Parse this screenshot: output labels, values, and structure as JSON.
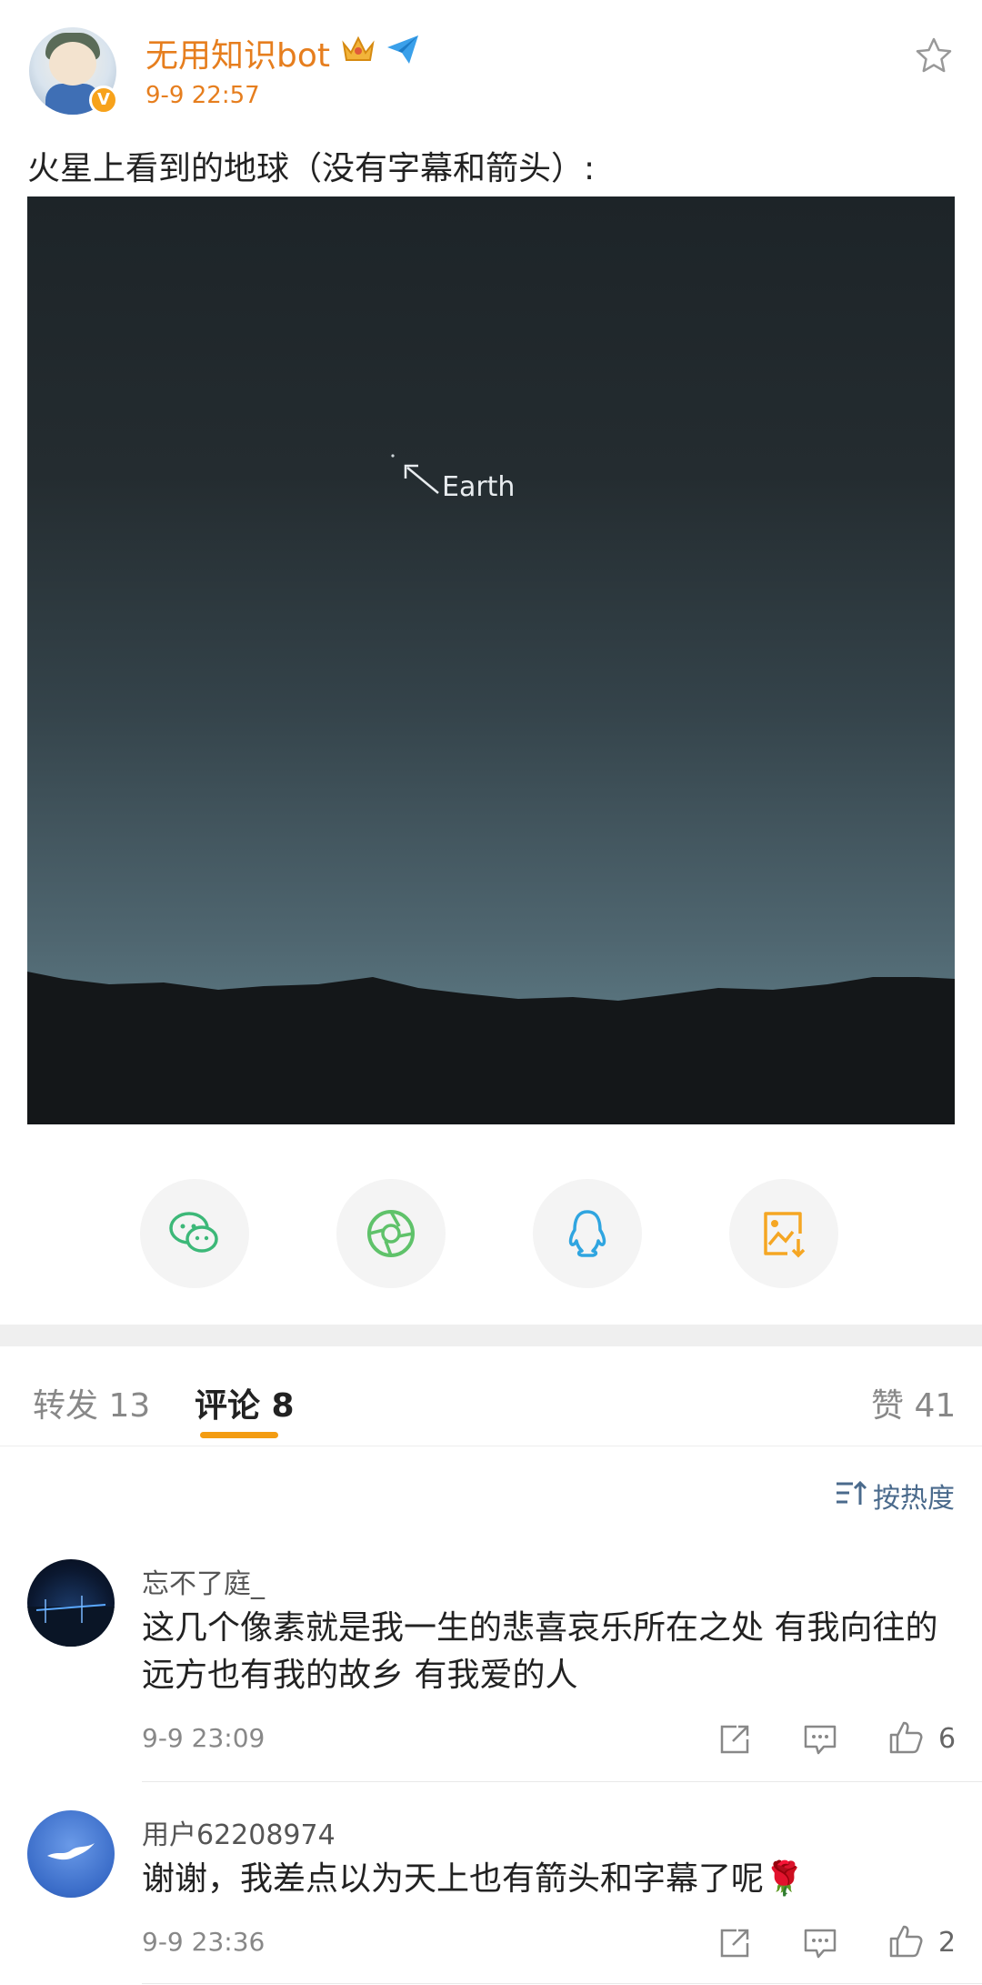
{
  "post": {
    "username": "无用知识bot",
    "timestamp": "9-9 22:57",
    "text": "火星上看到的地球（没有字幕和箭头）:",
    "image_caption": "Earth"
  },
  "share": {
    "items": [
      "wechat-icon",
      "moments-icon",
      "qq-icon",
      "save-image-icon"
    ]
  },
  "tabs": [
    {
      "label": "转发 13"
    },
    {
      "label": "评论 8"
    },
    {
      "label": "赞 41"
    }
  ],
  "sort": {
    "label": "按热度"
  },
  "comments": [
    {
      "name": "忘不了庭_",
      "text": "这几个像素就是我一生的悲喜哀乐所在之处 有我向往的远方也有我的故乡 有我爱的人",
      "time": "9-9 23:09",
      "likes": "6"
    },
    {
      "name": "用户62208974",
      "text": "谢谢，我差点以为天上也有箭头和字幕了呢🌹",
      "time": "9-9 23:36",
      "likes": "2"
    }
  ],
  "colors": {
    "accent": "#e67e1e",
    "tab_indicator": "#f39c12",
    "link": "#4a6a8c"
  }
}
